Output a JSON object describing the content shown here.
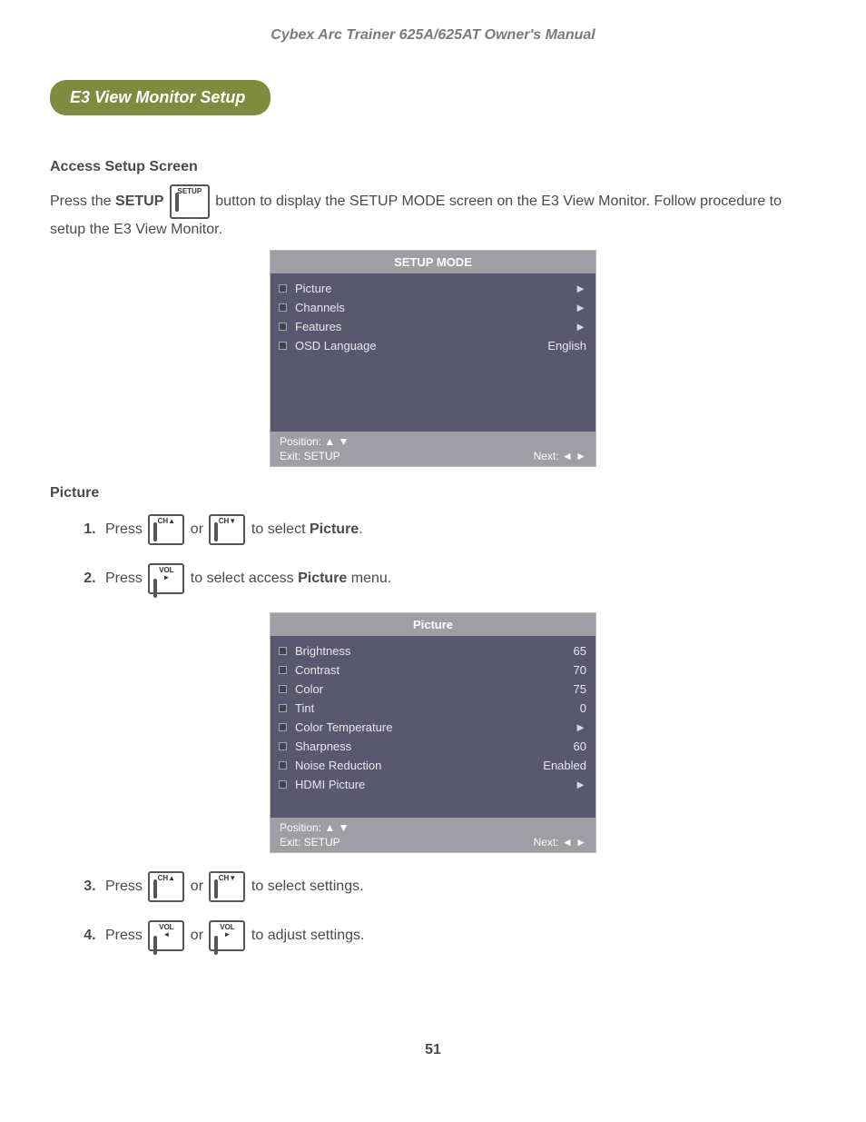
{
  "header": "Cybex Arc Trainer 625A/625AT Owner's Manual",
  "section_title": "E3 View Monitor Setup",
  "access": {
    "heading": "Access Setup Screen",
    "line_pre": "Press the ",
    "setup_bold": "SETUP",
    "line_post": " button to display the SETUP MODE screen on the E3 View Monitor. Follow procedure to setup the E3 View Monitor."
  },
  "setup_button_label": "SETUP",
  "osd1": {
    "title": "SETUP MODE",
    "rows": [
      {
        "label": "Picture",
        "value": "►"
      },
      {
        "label": "Channels",
        "value": "►"
      },
      {
        "label": "Features",
        "value": "►"
      },
      {
        "label": "OSD Language",
        "value": "English"
      }
    ],
    "footer_pos": "Position: ▲ ▼",
    "footer_exit": "Exit: SETUP",
    "footer_next": "Next: ◄ ►"
  },
  "picture": {
    "heading": "Picture",
    "step1_pre": "Press ",
    "step1_or": " or ",
    "step1_post": " to select ",
    "step1_bold": "Picture",
    "step1_period": ".",
    "step2_pre": "Press ",
    "step2_post": " to select access ",
    "step2_bold": "Picture",
    "step2_after": " menu.",
    "step3_pre": "Press ",
    "step3_or": " or ",
    "step3_post": " to select settings.",
    "step4_pre": "Press ",
    "step4_or": " or ",
    "step4_post": " to adjust settings."
  },
  "chup_label": "CH▲",
  "chdn_label": "CH▼",
  "volr_top": "VOL",
  "volr_arrow": "►",
  "voll_top": "VOL",
  "voll_arrow": "◄",
  "osd2": {
    "title": "Picture",
    "rows": [
      {
        "label": "Brightness",
        "value": "65"
      },
      {
        "label": "Contrast",
        "value": "70"
      },
      {
        "label": "Color",
        "value": "75"
      },
      {
        "label": "Tint",
        "value": "0"
      },
      {
        "label": "Color Temperature",
        "value": "►"
      },
      {
        "label": "Sharpness",
        "value": "60"
      },
      {
        "label": "Noise Reduction",
        "value": "Enabled"
      },
      {
        "label": "HDMI Picture",
        "value": "►"
      }
    ],
    "footer_pos": "Position: ▲ ▼",
    "footer_exit": "Exit: SETUP",
    "footer_next": "Next: ◄ ►"
  },
  "page_number": "51"
}
